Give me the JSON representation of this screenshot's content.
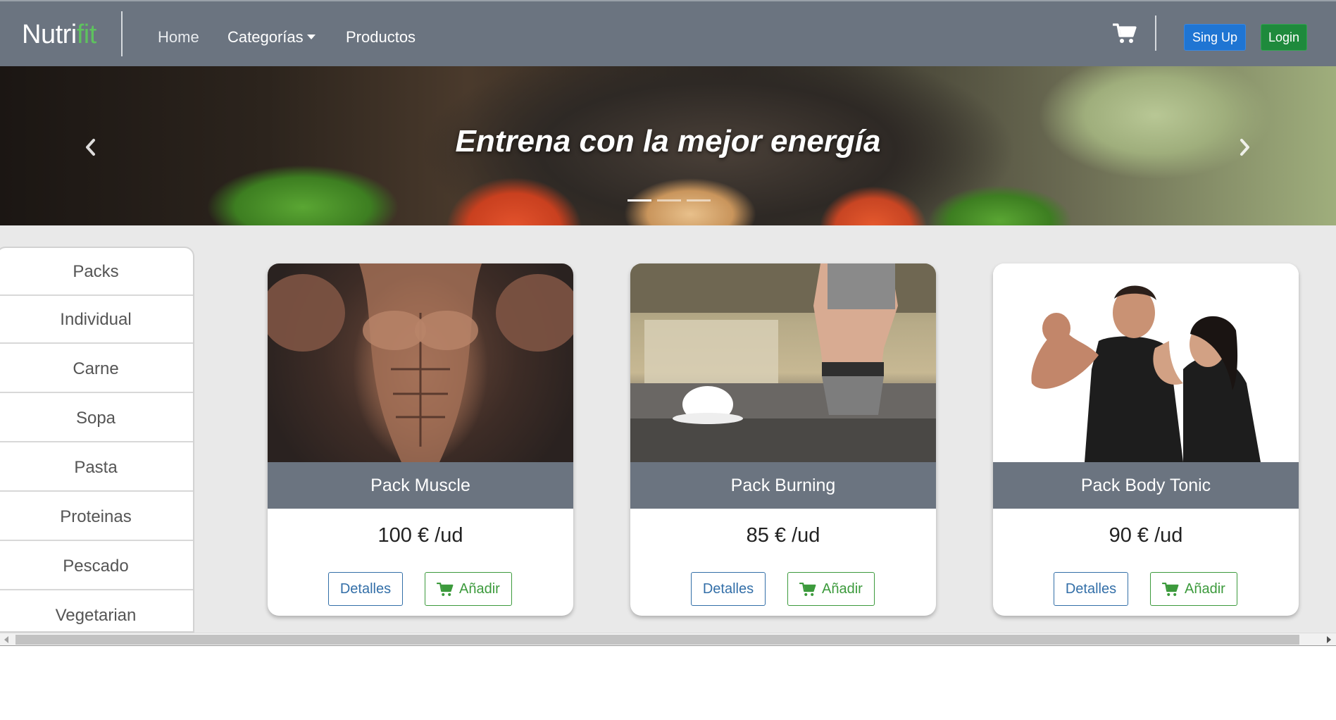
{
  "navbar": {
    "brand_prefix": "Nutri",
    "brand_suffix": "fit",
    "links": [
      {
        "label": "Home"
      },
      {
        "label": "Categorías"
      },
      {
        "label": "Productos"
      }
    ],
    "cart_icon": "shopping-cart-icon",
    "signup_label": "Sing Up",
    "login_label": "Login"
  },
  "hero": {
    "title": "Entrena con la mejor energía",
    "slides": 3,
    "active_slide": 1
  },
  "sidebar": {
    "items": [
      {
        "label": "Packs"
      },
      {
        "label": "Individual"
      },
      {
        "label": "Carne"
      },
      {
        "label": "Sopa"
      },
      {
        "label": "Pasta"
      },
      {
        "label": "Proteinas"
      },
      {
        "label": "Pescado"
      },
      {
        "label": "Vegetarian"
      }
    ]
  },
  "products": [
    {
      "title": "Pack Muscle",
      "price": "100 € /ud",
      "details_label": "Detalles",
      "add_label": "Añadir"
    },
    {
      "title": "Pack Burning",
      "price": "85 € /ud",
      "details_label": "Detalles",
      "add_label": "Añadir"
    },
    {
      "title": "Pack Body Tonic",
      "price": "90 € /ud",
      "details_label": "Detalles",
      "add_label": "Añadir"
    }
  ],
  "colors": {
    "navbar_bg": "#6b7480",
    "brand_accent": "#5ec25e",
    "signup_bg": "#1f75d3",
    "login_bg": "#1e8a3c",
    "details_border": "#336fa8",
    "add_border": "#3c9a3c"
  }
}
